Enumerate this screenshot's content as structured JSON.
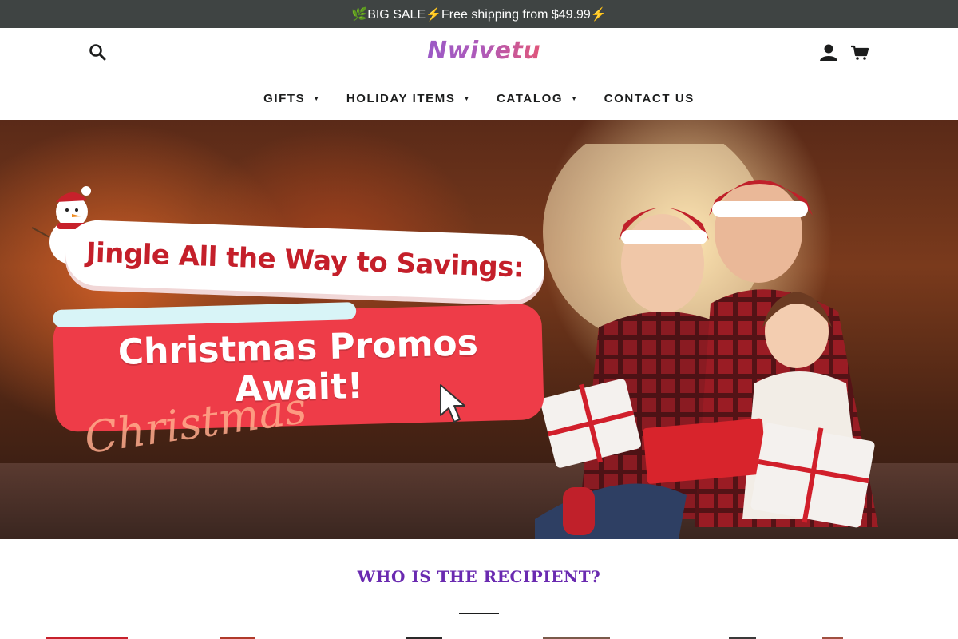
{
  "announcement": {
    "text": "🌿BIG SALE⚡Free shipping from $49.99⚡"
  },
  "header": {
    "logo_text": "Nwivetu",
    "search_icon": "search-icon",
    "account_icon": "user-icon",
    "cart_icon": "cart-icon"
  },
  "nav": {
    "items": [
      {
        "label": "GIFTS",
        "has_dropdown": true
      },
      {
        "label": "HOLIDAY ITEMS",
        "has_dropdown": true
      },
      {
        "label": "CATALOG",
        "has_dropdown": true
      },
      {
        "label": "CONTACT US",
        "has_dropdown": false
      }
    ]
  },
  "hero": {
    "headline_top": "Jingle All the Way to Savings:",
    "headline_main_line1": "Christmas Promos",
    "headline_main_line2": "Await!",
    "script_word": "Christmas"
  },
  "recipients": {
    "title": "WHO IS THE RECIPIENT?"
  },
  "colors": {
    "announcement_bg": "#3f4443",
    "accent_purple": "#6a2ab0",
    "promo_red": "#ee3c48",
    "logo_purple": "#9b59c6",
    "logo_pink": "#e0567a"
  }
}
